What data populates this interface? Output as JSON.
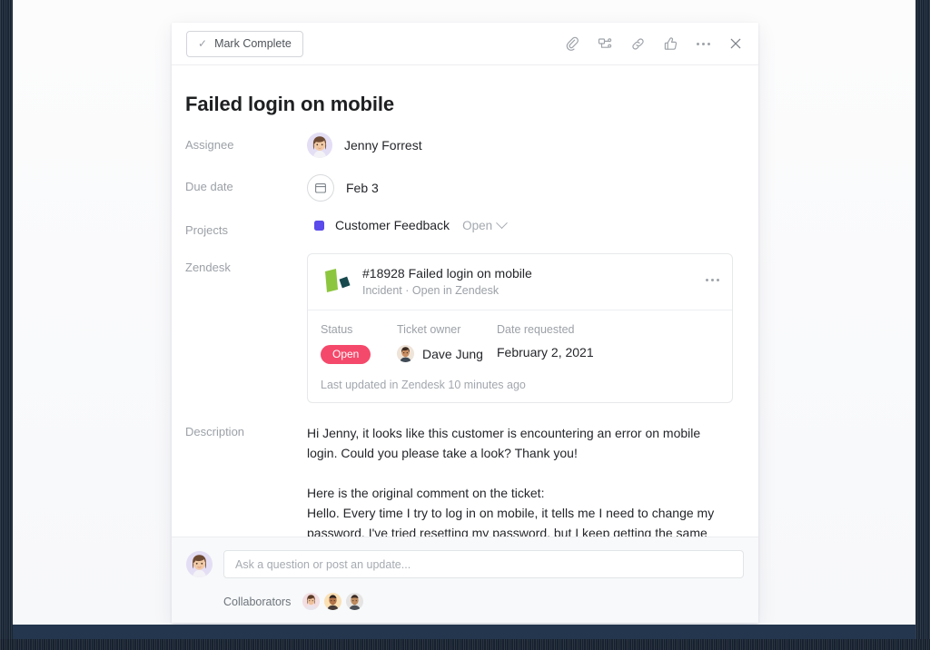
{
  "toolbar": {
    "mark_complete_label": "Mark Complete",
    "check_glyph": "✓",
    "icons": [
      {
        "name": "attachment-icon",
        "label": "Attach file"
      },
      {
        "name": "subtask-icon",
        "label": "Add subtask"
      },
      {
        "name": "link-icon",
        "label": "Copy task link"
      },
      {
        "name": "like-icon",
        "label": "Like"
      },
      {
        "name": "more-options-icon",
        "label": "More options"
      },
      {
        "name": "close-icon",
        "label": "Close"
      }
    ]
  },
  "task": {
    "title": "Failed login on mobile",
    "fields": {
      "assignee_label": "Assignee",
      "assignee_name": "Jenny Forrest",
      "due_date_label": "Due date",
      "due_date_value": "Feb 3",
      "projects_label": "Projects",
      "project_name": "Customer Feedback",
      "project_color": "#5a4bea",
      "project_status": "Open",
      "zendesk_label": "Zendesk",
      "description_label": "Description"
    },
    "description": "Hi Jenny, it looks like this customer is encountering an error on mobile login. Could you please take a look? Thank you!\n\nHere is the original comment on the ticket:\nHello. Every time I try to log in on mobile, it tells me I need to change my password. I've tried resetting my password, but I keep getting the same error. Help!"
  },
  "zendesk_card": {
    "ticket_title": "#18928 Failed login on mobile",
    "ticket_type": "Incident",
    "separator": "·",
    "open_link": "Open in Zendesk",
    "menu_label": "Ticket options",
    "columns": [
      {
        "header": "Status",
        "value": "Open"
      },
      {
        "header": "Ticket owner",
        "value": "Dave Jung"
      },
      {
        "header": "Date requested",
        "value": "February 2, 2021"
      }
    ],
    "status_badge_color": "#f5496b",
    "last_updated": "Last updated in Zendesk 10 minutes ago",
    "logo_green": "#8cc63e",
    "logo_teal": "#17494d"
  },
  "footer": {
    "comment_placeholder": "Ask a question or post an update...",
    "comment_value": "",
    "collaborators_label": "Collaborators",
    "collaborator_count": 3
  }
}
